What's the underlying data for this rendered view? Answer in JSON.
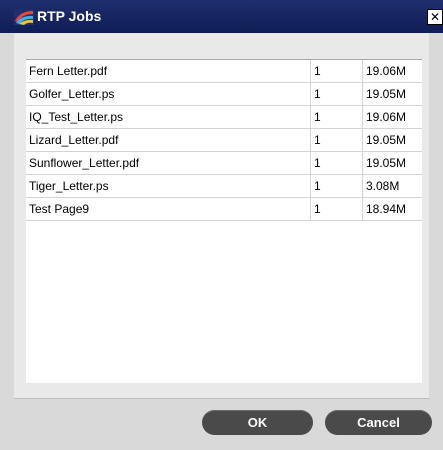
{
  "window": {
    "title": "RTP Jobs",
    "close_label": "✕"
  },
  "jobs": [
    {
      "name": "Fern Letter.pdf",
      "copies": "1",
      "size": "19.06M"
    },
    {
      "name": "Golfer_Letter.ps",
      "copies": "1",
      "size": "19.05M"
    },
    {
      "name": "IQ_Test_Letter.ps",
      "copies": "1",
      "size": "19.06M"
    },
    {
      "name": "Lizard_Letter.pdf",
      "copies": "1",
      "size": "19.05M"
    },
    {
      "name": "Sunflower_Letter.pdf",
      "copies": "1",
      "size": "19.05M"
    },
    {
      "name": "Tiger_Letter.ps",
      "copies": "1",
      "size": "3.08M"
    },
    {
      "name": "Test Page9",
      "copies": "1",
      "size": "18.94M"
    }
  ],
  "buttons": {
    "ok": "OK",
    "cancel": "Cancel"
  },
  "icons": {
    "title_icon": "app-logo-icon",
    "close_icon": "close-icon"
  },
  "colors": {
    "titlebar": "#0f1d55",
    "button": "#4a4a4a"
  }
}
